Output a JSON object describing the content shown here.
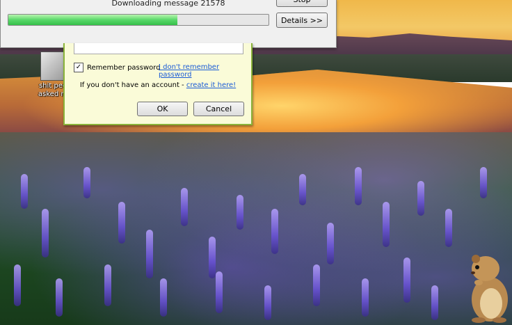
{
  "download_window": {
    "message": "Downloading message 21578",
    "progress_percent": 65,
    "stop_label": "Stop",
    "details_label": "Details >>"
  },
  "login_dialog": {
    "password_value": "",
    "remember_label": "Remember password",
    "remember_checked": true,
    "checkbox_glyph": "✓",
    "forgot_link": "I don't remember password",
    "signup_prefix": "If you don't have an account - ",
    "signup_link": "create it here!",
    "ok_label": "OK",
    "cancel_label": "Cancel"
  },
  "desktop": {
    "icon_label_line1": "shit peo",
    "icon_label_line2": "asked m"
  },
  "colors": {
    "progress_fill": "#5ad86a",
    "dialog_bg": "#fafbd8",
    "dialog_border": "#8ab33a",
    "link": "#1a5bd6"
  },
  "icons": [
    "checkbox-icon",
    "document-thumbnail-icon",
    "hamster-mascot-icon"
  ]
}
